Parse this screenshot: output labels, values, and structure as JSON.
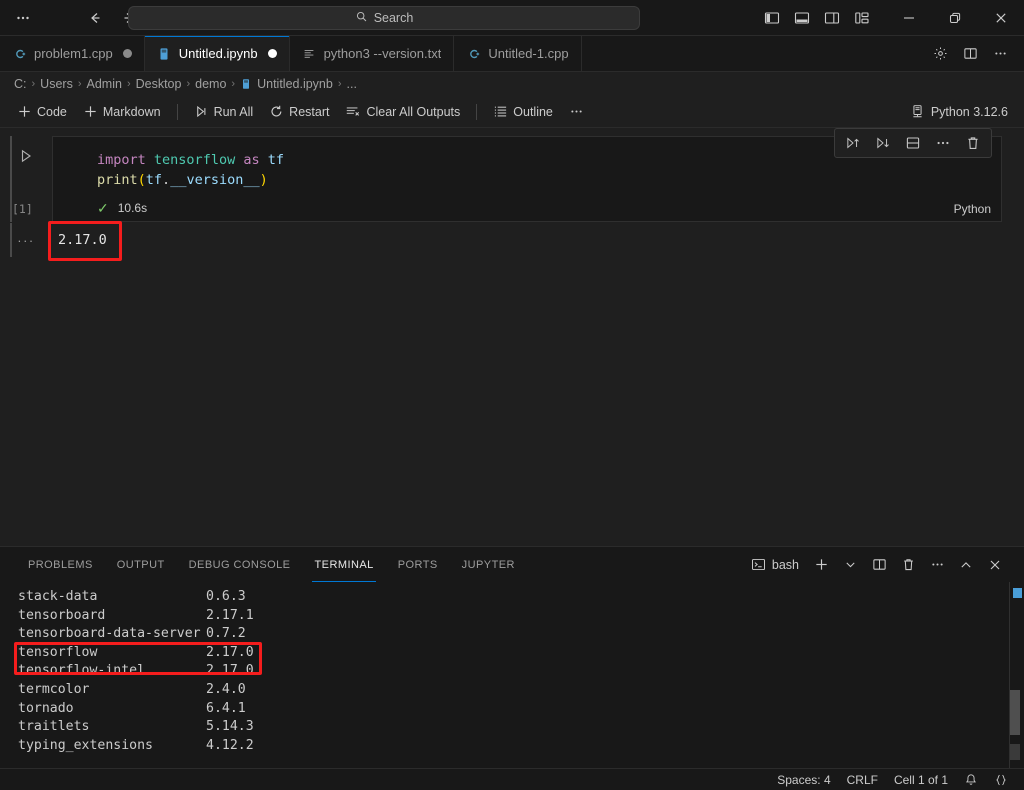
{
  "titlebar": {
    "menu_icon": "ellipsis-icon",
    "back_icon": "arrow-left-icon",
    "forward_icon": "arrow-right-icon",
    "search_placeholder": "Search",
    "search_value": "",
    "search_icon": "search-icon",
    "layout_buttons": [
      {
        "name": "toggle-primary-sidebar",
        "icon": "layout-sidebar-left-icon"
      },
      {
        "name": "toggle-panel",
        "icon": "layout-panel-icon"
      },
      {
        "name": "toggle-secondary-sidebar",
        "icon": "layout-sidebar-right-icon"
      },
      {
        "name": "customize-layout",
        "icon": "layout-customize-icon"
      }
    ],
    "window_controls": [
      {
        "name": "minimize-button",
        "glyph": "─"
      },
      {
        "name": "restore-button",
        "glyph": "❐"
      },
      {
        "name": "close-button",
        "glyph": "✕"
      }
    ]
  },
  "tabs": [
    {
      "label": "problem1.cpp",
      "icon": "cpp-file-icon",
      "active": false,
      "dirty": true
    },
    {
      "label": "Untitled.ipynb",
      "icon": "notebook-file-icon",
      "active": true,
      "dirty": true
    },
    {
      "label": "python3 --version.txt",
      "icon": "text-file-icon",
      "active": false,
      "dirty": false
    },
    {
      "label": "Untitled-1.cpp",
      "icon": "cpp-file-icon",
      "active": false,
      "dirty": false
    }
  ],
  "tabbar_actions": [
    {
      "name": "notebook-settings-button",
      "icon": "gear-icon"
    },
    {
      "name": "split-editor-button",
      "icon": "split-editor-icon"
    },
    {
      "name": "editor-more-actions-button",
      "icon": "ellipsis-icon"
    }
  ],
  "breadcrumb": {
    "items": [
      "C:",
      "Users",
      "Admin",
      "Desktop",
      "demo",
      "Untitled.ipynb",
      "..."
    ],
    "separator": "›",
    "file_icon": "notebook-file-icon"
  },
  "notebook_toolbar": {
    "items": [
      {
        "label": "Code",
        "icon": "plus-icon",
        "name": "add-code-cell-button"
      },
      {
        "label": "Markdown",
        "icon": "plus-icon",
        "name": "add-markdown-cell-button"
      },
      {
        "label": "Run All",
        "icon": "run-all-icon",
        "name": "run-all-button"
      },
      {
        "label": "Restart",
        "icon": "restart-icon",
        "name": "restart-kernel-button"
      },
      {
        "label": "Clear All Outputs",
        "icon": "clear-all-icon",
        "name": "clear-all-outputs-button"
      },
      {
        "label": "Outline",
        "icon": "outline-icon",
        "name": "outline-button"
      },
      {
        "label": "…",
        "icon": "ellipsis-icon",
        "name": "notebook-more-actions-button"
      }
    ],
    "kernel_label": "Python 3.12.6",
    "kernel_icon": "kernel-icon"
  },
  "cell_toolbar": [
    {
      "name": "run-above-button",
      "icon": "run-above-icon"
    },
    {
      "name": "run-below-button",
      "icon": "run-below-icon"
    },
    {
      "name": "split-cell-button",
      "icon": "split-cell-icon"
    },
    {
      "name": "cell-more-actions-button",
      "icon": "ellipsis-icon"
    },
    {
      "name": "delete-cell-button",
      "icon": "trash-icon"
    }
  ],
  "cell": {
    "run_icon": "play-icon",
    "execution_count": "[1]",
    "code_line1": {
      "kw": "import",
      "module": "tensorflow",
      "as": "as",
      "alias": "tf"
    },
    "code_line2": {
      "fn": "print",
      "open": "(",
      "obj": "tf",
      "dot": ".",
      "attr": "__version__",
      "close": ")"
    },
    "status_check": "✓",
    "elapsed": "10.6s",
    "language": "Python",
    "output_dots": "···",
    "output_text": "2.17.0",
    "output_highlight_color": "#f51d1d"
  },
  "panel": {
    "tabs": [
      {
        "label": "PROBLEMS",
        "active": false
      },
      {
        "label": "OUTPUT",
        "active": false
      },
      {
        "label": "DEBUG CONSOLE",
        "active": false
      },
      {
        "label": "TERMINAL",
        "active": true
      },
      {
        "label": "PORTS",
        "active": false
      },
      {
        "label": "JUPYTER",
        "active": false
      }
    ],
    "terminal_chip": {
      "label": "bash",
      "icon": "terminal-icon"
    },
    "actions": [
      {
        "name": "new-terminal-button",
        "icon": "plus-icon"
      },
      {
        "name": "terminal-profile-dropdown",
        "icon": "chevron-down-icon"
      },
      {
        "name": "split-terminal-button",
        "icon": "split-terminal-icon"
      },
      {
        "name": "kill-terminal-button",
        "icon": "trash-icon"
      },
      {
        "name": "panel-more-actions-button",
        "icon": "ellipsis-icon"
      },
      {
        "name": "maximize-panel-button",
        "icon": "chevron-up-icon"
      },
      {
        "name": "close-panel-button",
        "icon": "close-icon"
      }
    ],
    "terminal_rows": [
      {
        "name": "stack-data",
        "version": "0.6.3",
        "highlighted": false
      },
      {
        "name": "tensorboard",
        "version": "2.17.1",
        "highlighted": false
      },
      {
        "name": "tensorboard-data-server",
        "version": "0.7.2",
        "highlighted": false
      },
      {
        "name": "tensorflow",
        "version": "2.17.0",
        "highlighted": true
      },
      {
        "name": "tensorflow-intel",
        "version": "2.17.0",
        "highlighted": true
      },
      {
        "name": "termcolor",
        "version": "2.4.0",
        "highlighted": false
      },
      {
        "name": "tornado",
        "version": "6.4.1",
        "highlighted": false
      },
      {
        "name": "traitlets",
        "version": "5.14.3",
        "highlighted": false
      },
      {
        "name": "typing_extensions",
        "version": "4.12.2",
        "highlighted": false
      }
    ],
    "highlight_color": "#f51d1d"
  },
  "statusbar": {
    "items": [
      {
        "label": "Spaces: 4",
        "name": "status-indentation"
      },
      {
        "label": "CRLF",
        "name": "status-eol"
      },
      {
        "label": "Cell 1 of 1",
        "name": "status-cell-position"
      }
    ],
    "bell_icon": "bell-icon",
    "braces_icon": "braces-icon"
  },
  "colors": {
    "accent": "#0078d4",
    "editor_bg": "#1f1f1f",
    "chrome_bg": "#181818",
    "highlight_red": "#f51d1d",
    "success_green": "#7ec96a"
  }
}
